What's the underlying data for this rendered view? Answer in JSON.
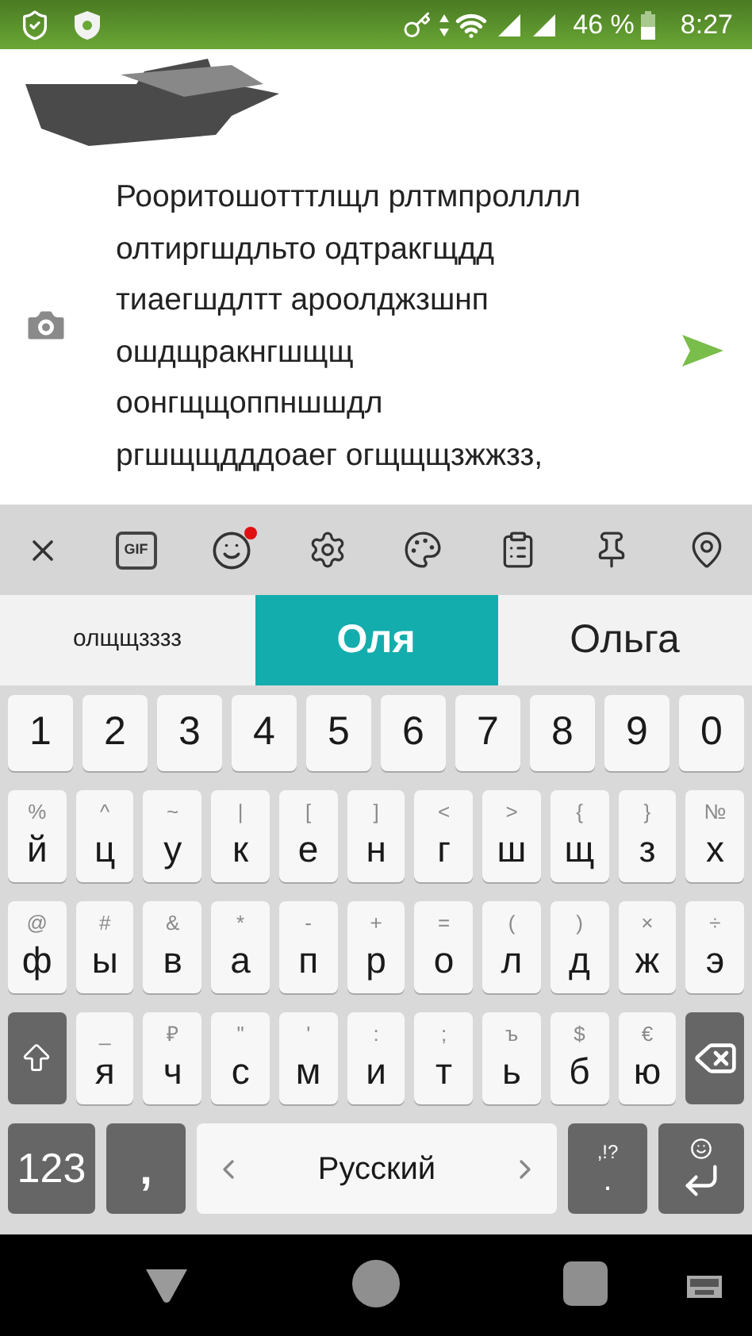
{
  "status_bar": {
    "battery": "46 %",
    "time": "8:27"
  },
  "message": {
    "text": "Рооритошотттлщл рлтмпролллл\nолтиргшдльто одтракгщдд\nтиаегшдлтт ароолджзшнп\nошдщракнгшщщ\nоонгщщоппншшдл\nргшщщдддоаег огщщщзжжзз,"
  },
  "toolbar": {
    "gif": "GIF",
    "sticker_badge": true
  },
  "suggestions": [
    {
      "text": "олщщзззз",
      "selected": false
    },
    {
      "text": "Оля",
      "selected": true
    },
    {
      "text": "Ольга",
      "selected": false
    }
  ],
  "number_row": [
    "1",
    "2",
    "3",
    "4",
    "5",
    "6",
    "7",
    "8",
    "9",
    "0"
  ],
  "letter_rows": [
    [
      {
        "kind": "letter",
        "label": "й",
        "hint": "%"
      },
      {
        "kind": "letter",
        "label": "ц",
        "hint": "^"
      },
      {
        "kind": "letter",
        "label": "у",
        "hint": "~"
      },
      {
        "kind": "letter",
        "label": "к",
        "hint": "|"
      },
      {
        "kind": "letter",
        "label": "е",
        "hint": "["
      },
      {
        "kind": "letter",
        "label": "н",
        "hint": "]"
      },
      {
        "kind": "letter",
        "label": "г",
        "hint": "<"
      },
      {
        "kind": "letter",
        "label": "ш",
        "hint": ">"
      },
      {
        "kind": "letter",
        "label": "щ",
        "hint": "{"
      },
      {
        "kind": "letter",
        "label": "з",
        "hint": "}"
      },
      {
        "kind": "letter",
        "label": "х",
        "hint": "№"
      }
    ],
    [
      {
        "kind": "letter",
        "label": "ф",
        "hint": "@"
      },
      {
        "kind": "letter",
        "label": "ы",
        "hint": "#"
      },
      {
        "kind": "letter",
        "label": "в",
        "hint": "&"
      },
      {
        "kind": "letter",
        "label": "а",
        "hint": "*"
      },
      {
        "kind": "letter",
        "label": "п",
        "hint": "-"
      },
      {
        "kind": "letter",
        "label": "р",
        "hint": "+"
      },
      {
        "kind": "letter",
        "label": "о",
        "hint": "="
      },
      {
        "kind": "letter",
        "label": "л",
        "hint": "("
      },
      {
        "kind": "letter",
        "label": "д",
        "hint": ")"
      },
      {
        "kind": "letter",
        "label": "ж",
        "hint": "×"
      },
      {
        "kind": "letter",
        "label": "э",
        "hint": "÷"
      }
    ],
    [
      {
        "kind": "shift"
      },
      {
        "kind": "letter",
        "label": "я",
        "hint": "_"
      },
      {
        "kind": "letter",
        "label": "ч",
        "hint": "₽"
      },
      {
        "kind": "letter",
        "label": "с",
        "hint": "\""
      },
      {
        "kind": "letter",
        "label": "м",
        "hint": "'"
      },
      {
        "kind": "letter",
        "label": "и",
        "hint": ":"
      },
      {
        "kind": "letter",
        "label": "т",
        "hint": ";"
      },
      {
        "kind": "letter",
        "label": "ь",
        "hint": "ъ"
      },
      {
        "kind": "letter",
        "label": "б",
        "hint": "$"
      },
      {
        "kind": "letter",
        "label": "ю",
        "hint": "€"
      },
      {
        "kind": "backspace"
      }
    ]
  ],
  "bottom_row": [
    {
      "kind": "mode",
      "label": "123"
    },
    {
      "kind": "comma",
      "label": ","
    },
    {
      "kind": "space",
      "label": "Русский"
    },
    {
      "kind": "punct",
      "label": ".",
      "hint": ",!?"
    },
    {
      "kind": "enter"
    }
  ]
}
